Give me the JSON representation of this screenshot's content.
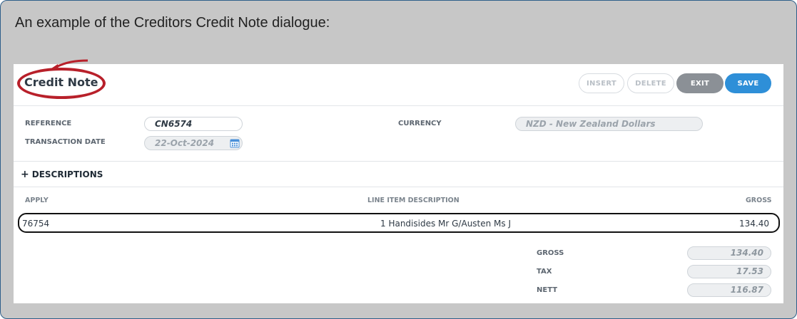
{
  "caption": "An example of the Creditors Credit Note dialogue:",
  "dialog": {
    "title": "Credit Note",
    "buttons": {
      "insert": "INSERT",
      "delete": "DELETE",
      "exit": "EXIT",
      "save": "SAVE"
    },
    "fields": {
      "reference_label": "REFERENCE",
      "reference_value": "CN6574",
      "transaction_date_label": "TRANSACTION DATE",
      "transaction_date_value": "22-Oct-2024",
      "currency_label": "CURRENCY",
      "currency_value": "NZD - New Zealand Dollars"
    },
    "descriptions_label": "DESCRIPTIONS",
    "descriptions_toggle": "+",
    "table": {
      "columns": {
        "apply": "APPLY",
        "line_item": "LINE ITEM DESCRIPTION",
        "gross": "GROSS"
      },
      "rows": [
        {
          "apply": "76754",
          "line_item": "1 Handisides Mr G/Austen Ms J",
          "gross": "134.40"
        }
      ]
    },
    "totals": {
      "gross_label": "GROSS",
      "gross_value": "134.40",
      "tax_label": "TAX",
      "tax_value": "17.53",
      "nett_label": "NETT",
      "nett_value": "116.87"
    }
  },
  "colors": {
    "highlight": "#b8202a",
    "save": "#2e8fd8",
    "exit": "#8b9096"
  }
}
